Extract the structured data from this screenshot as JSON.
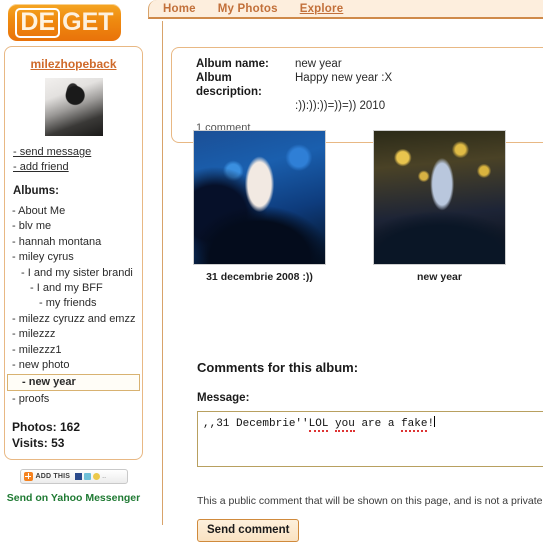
{
  "site": {
    "logo_de": "DE",
    "logo_get": "GET"
  },
  "nav": {
    "items": [
      {
        "label": "Home",
        "active": false
      },
      {
        "label": "My Photos",
        "active": false
      },
      {
        "label": "Explore",
        "active": true
      }
    ]
  },
  "sidebar": {
    "username": "milezhopeback",
    "links": [
      {
        "label": "- send message"
      },
      {
        "label": "- add friend"
      }
    ],
    "albums_heading": "Albums:",
    "albums": [
      {
        "label": "- About Me",
        "level": 0,
        "selected": false
      },
      {
        "label": "- blv me",
        "level": 0,
        "selected": false
      },
      {
        "label": "- hannah montana",
        "level": 0,
        "selected": false
      },
      {
        "label": "- miley cyrus",
        "level": 0,
        "selected": false
      },
      {
        "label": "- I and my sister brandi",
        "level": 1,
        "selected": false
      },
      {
        "label": "- I and my BFF",
        "level": 2,
        "selected": false
      },
      {
        "label": "- my friends",
        "level": 3,
        "selected": false
      },
      {
        "label": "- milezz cyruzz and emzz",
        "level": 0,
        "selected": false
      },
      {
        "label": "- milezzz",
        "level": 0,
        "selected": false
      },
      {
        "label": "- milezzz1",
        "level": 0,
        "selected": false
      },
      {
        "label": "- new photo",
        "level": 0,
        "selected": false
      },
      {
        "label": "- new year",
        "level": 1,
        "selected": true
      },
      {
        "label": "- proofs",
        "level": 0,
        "selected": false
      }
    ],
    "stats": {
      "photos": "Photos: 162",
      "visits": "Visits: 53"
    },
    "addthis": {
      "label": "ADD THIS",
      "dots": ".."
    },
    "yahoo_link": "Send on Yahoo Messenger"
  },
  "album": {
    "name_label": "Album name:",
    "name_value": "new year",
    "description_label": "Album description:",
    "description_line1": "Happy new year :X",
    "description_line2": ":)):)):))=))=)) 2010",
    "comment_count": "1 comment"
  },
  "photos": [
    {
      "caption": "31 decembrie 2008 :))"
    },
    {
      "caption": "new year"
    }
  ],
  "comments": {
    "title": "Comments for this album:",
    "message_label": "Message:",
    "message_prefix": ",,31 Decembrie''",
    "message_word_lol": "LOL",
    "message_word_you": "you",
    "message_mid": " are a ",
    "message_word_fake": "fake",
    "message_suffix": "!",
    "notice": "This a public comment that will be shown on this page, and is not a private m",
    "send_label": "Send comment"
  },
  "colors": {
    "brand_orange": "#ef8b10",
    "nav_text": "#c2703a",
    "panel_border": "#e8b884",
    "username": "#cf6a2a",
    "yahoo_green": "#1f7a33"
  }
}
